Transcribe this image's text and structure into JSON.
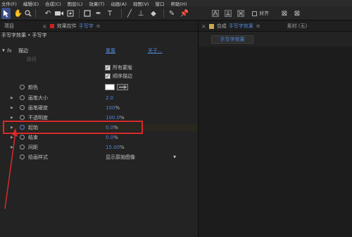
{
  "menu": [
    "文件(F)",
    "编辑(E)",
    "合成(C)",
    "图层(L)",
    "效果(T)",
    "动画(A)",
    "视图(V)",
    "窗口",
    "帮助(H)"
  ],
  "toolbar": {
    "snap_label": "对齐"
  },
  "effects_panel": {
    "tab_project": "项目",
    "tab_effects_prefix": "效果控件",
    "tab_effects_layer": "手写字",
    "breadcrumb": "手写字效果 • 手写字",
    "fx_badge": "fx",
    "effect_name": "描边",
    "reset_label": "重置",
    "about_label": "关于...",
    "path_label": "路径",
    "all_masks_label": "所有蒙版",
    "sequential_label": "顺序描边",
    "properties": [
      {
        "name": "颜色",
        "value": "",
        "unit": ""
      },
      {
        "name": "画笔大小",
        "value": "2.0",
        "unit": ""
      },
      {
        "name": "画笔硬度",
        "value": "100",
        "unit": "%"
      },
      {
        "name": "不透明度",
        "value": "100.0",
        "unit": "%"
      },
      {
        "name": "起始",
        "value": "0.0",
        "unit": "%"
      },
      {
        "name": "结束",
        "value": "0.0",
        "unit": "%"
      },
      {
        "name": "间距",
        "value": "15.00",
        "unit": "%"
      },
      {
        "name": "绘画样式",
        "value": "显示原始图像",
        "unit": ""
      }
    ],
    "color_swatch": "#ffffff",
    "highlight_color": "#d82a2a"
  },
  "comp_panel": {
    "tab_prefix": "合成",
    "tab_name": "手写字效果",
    "footage_label": "素材 (无)",
    "sub_tab": "手写字效果"
  }
}
